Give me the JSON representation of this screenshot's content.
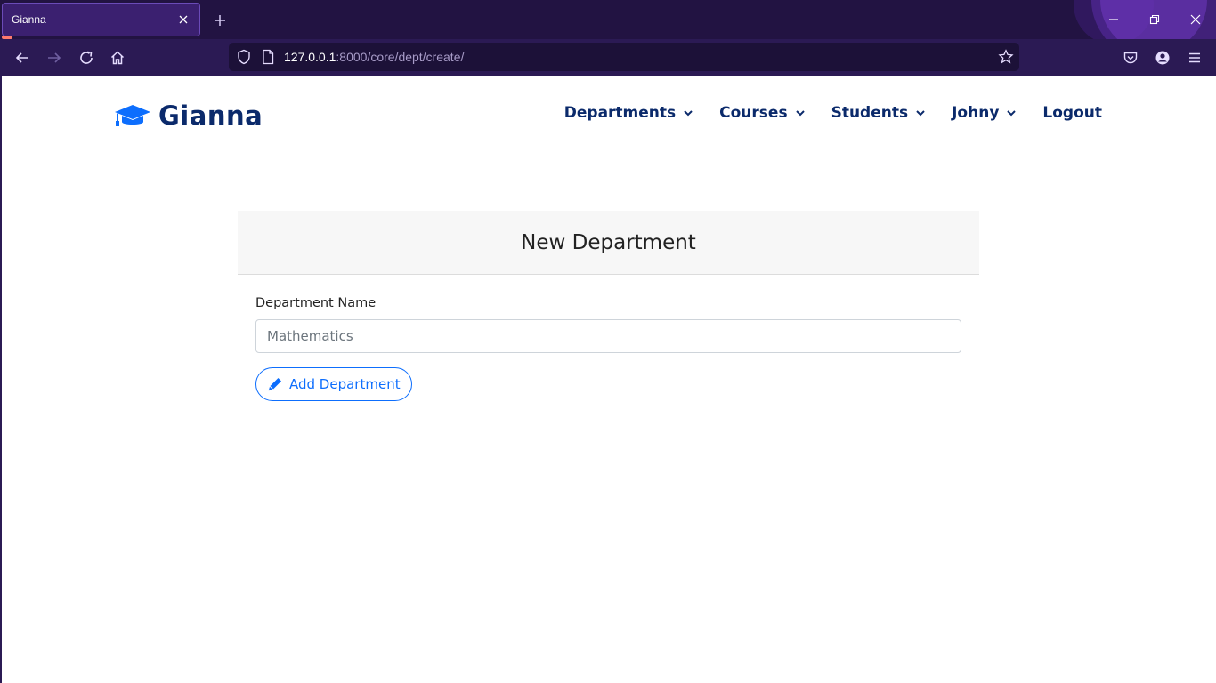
{
  "browser": {
    "tab_title": "Gianna",
    "url_host": "127.0.0.1",
    "url_rest": ":8000/core/dept/create/"
  },
  "site": {
    "brand_name": "Gianna",
    "brand_color": "#0b2a6b",
    "brand_icon": "graduation-cap-icon",
    "accent_color": "#0d6efd"
  },
  "nav": {
    "departments": "Departments",
    "courses": "Courses",
    "students": "Students",
    "user": "Johny",
    "logout": "Logout"
  },
  "form": {
    "title": "New Department",
    "field_label": "Department Name",
    "field_placeholder": "Mathematics",
    "field_value": "",
    "submit_label": "Add Department",
    "submit_icon": "pen-icon"
  }
}
